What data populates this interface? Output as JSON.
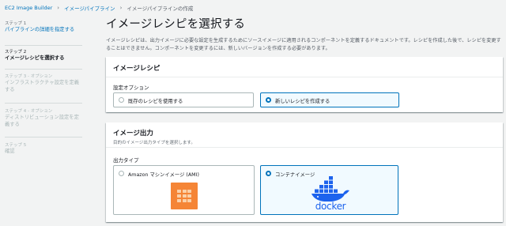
{
  "breadcrumb": {
    "items": [
      "EC2 Image Builder",
      "イメージパイプライン",
      "イメージパイプラインの作成"
    ],
    "separator": "›"
  },
  "steps": [
    {
      "num": "ステップ 1",
      "title": "パイプラインの詳細を指定する",
      "state": "link"
    },
    {
      "num": "ステップ 2",
      "title": "イメージレシピを選択する",
      "state": "active"
    },
    {
      "num": "ステップ 3 - オプション",
      "title": "インフラストラクチャ設定を定義する",
      "state": "disabled"
    },
    {
      "num": "ステップ 4 - オプション",
      "title": "ディストリビューション設定を定義する",
      "state": "disabled"
    },
    {
      "num": "ステップ 5",
      "title": "確認",
      "state": "disabled"
    }
  ],
  "page": {
    "title": "イメージレシピを選択する",
    "description": "イメージレシピは、出力イメージに必要な設定を生成するためにソースイメージに適用されるコンポーネントを定義するドキュメントです。レシピを作成した後で、レシピを変更することはできません。コンポーネントを変更するには、新しいバージョンを作成する必要があります。"
  },
  "recipe_panel": {
    "title": "イメージレシピ",
    "field_label": "設定オプション",
    "options": [
      {
        "label": "既存のレシピを使用する",
        "selected": false
      },
      {
        "label": "新しいレシピを作成する",
        "selected": true
      }
    ]
  },
  "output_panel": {
    "title": "イメージ出力",
    "subtitle": "目的のイメージ出力タイプを選択します。",
    "field_label": "出力タイプ",
    "options": [
      {
        "label": "Amazon マシンイメージ (AMI)",
        "selected": false,
        "icon": "ami-icon"
      },
      {
        "label": "コンテナイメージ",
        "selected": true,
        "icon": "docker-logo"
      }
    ],
    "docker_wordmark": "docker"
  },
  "colors": {
    "link": "#0073bb",
    "selected_border": "#0073bb",
    "selected_bg": "#f1faff",
    "ami_orange": "#f58536",
    "docker_blue": "#1d63ed"
  }
}
